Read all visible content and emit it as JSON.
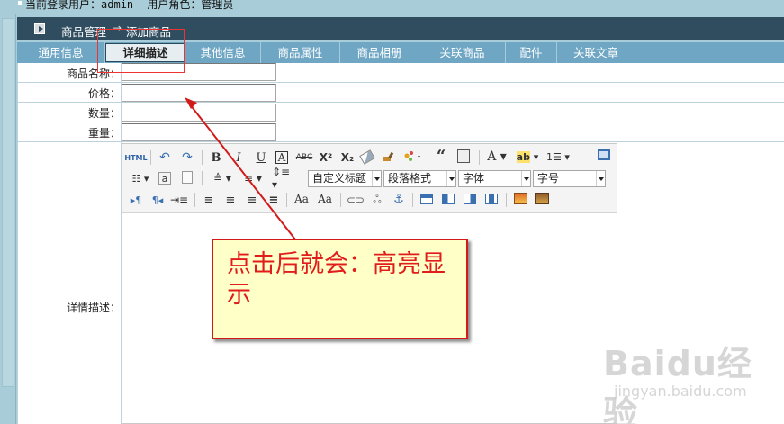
{
  "user_bar": {
    "user_label": "当前登录用户：",
    "user_name": "admin",
    "role_label": "用户角色：",
    "role_name": "管理员"
  },
  "breadcrumb": {
    "section": "商品管理",
    "separator": "→",
    "page": "添加商品"
  },
  "tabs": [
    {
      "label": "通用信息",
      "active": false
    },
    {
      "label": "详细描述",
      "active": true
    },
    {
      "label": "其他信息",
      "active": false
    },
    {
      "label": "商品属性",
      "active": false
    },
    {
      "label": "商品相册",
      "active": false
    },
    {
      "label": "关联商品",
      "active": false
    },
    {
      "label": "配件",
      "active": false
    },
    {
      "label": "关联文章",
      "active": false
    }
  ],
  "form": {
    "name_label": "商品名称：",
    "price_label": "价格：",
    "qty_label": "数量：",
    "weight_label": "重量：",
    "detail_label": "详情描述："
  },
  "editor": {
    "html_label": "HTML",
    "custom_title": "自定义标题",
    "paragraph_format": "段落格式",
    "font_family": "字体",
    "font_size": "字号"
  },
  "annotation": {
    "text": "点击后就会：高亮显示"
  },
  "watermark": {
    "brand": "Baidu经验",
    "url": "jingyan.baidu.com"
  },
  "colors": {
    "tab_bar": "#6ea6c4",
    "breadcrumb_bar": "#2f4d5f",
    "annotation_red": "#e01c1c",
    "note_bg": "#ffffc8"
  }
}
